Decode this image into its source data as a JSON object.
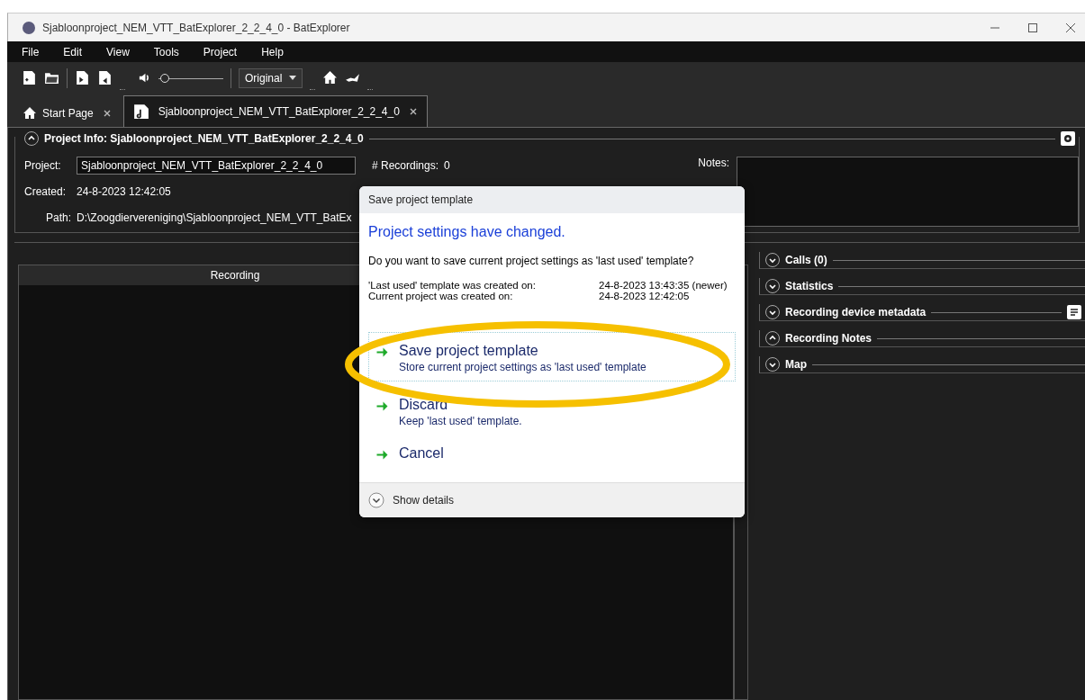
{
  "window": {
    "title": "Sjabloonproject_NEM_VTT_BatExplorer_2_2_4_0 - BatExplorer"
  },
  "menu": [
    "File",
    "Edit",
    "View",
    "Tools",
    "Project",
    "Help"
  ],
  "toolbar": {
    "volume": {
      "level": 0.1
    },
    "view_mode": "Original"
  },
  "tabs": [
    {
      "label": "Start Page",
      "kind": "home",
      "selected": false
    },
    {
      "label": "Sjabloonproject_NEM_VTT_BatExplorer_2_2_4_0",
      "kind": "project",
      "selected": true
    }
  ],
  "project_info": {
    "title": "Project Info: Sjabloonproject_NEM_VTT_BatExplorer_2_2_4_0",
    "expanded": true,
    "project_label": "Project:",
    "project_value": "Sjabloonproject_NEM_VTT_BatExplorer_2_2_4_0",
    "recordings_label": "# Recordings:",
    "recordings_value": "0",
    "created_label": "Created:",
    "created_value": "24-8-2023 12:42:05",
    "path_label": "Path:",
    "path_value": "D:\\Zoogdiervereniging\\Sjabloonproject_NEM_VTT_BatEx",
    "notes_label": "Notes:"
  },
  "table": {
    "columns": [
      "Recording"
    ]
  },
  "sections": [
    {
      "title": "Calls (0)",
      "expanded": false
    },
    {
      "title": "Statistics",
      "expanded": false
    },
    {
      "title": "Recording device metadata",
      "expanded": false,
      "kind": "notes"
    },
    {
      "title": "Recording Notes",
      "expanded": true
    },
    {
      "title": "Map",
      "expanded": false
    }
  ],
  "dialog": {
    "title": "Save project template",
    "heading": "Project settings have changed.",
    "question": "Do you want to save current project settings as 'last used' template?",
    "info": [
      {
        "label": "'Last used' template was created on:",
        "value": "24-8-2023 13:43:35 (newer)"
      },
      {
        "label": "Current project was created on:",
        "value": "24-8-2023 12:42:05"
      }
    ],
    "choices": [
      {
        "title": "Save project template",
        "description": "Store current project settings as 'last used' template",
        "focused": true
      },
      {
        "title": "Discard",
        "description": "Keep 'last used' template.",
        "focused": false
      },
      {
        "title": "Cancel",
        "focused": false
      }
    ],
    "details": "Show details"
  }
}
